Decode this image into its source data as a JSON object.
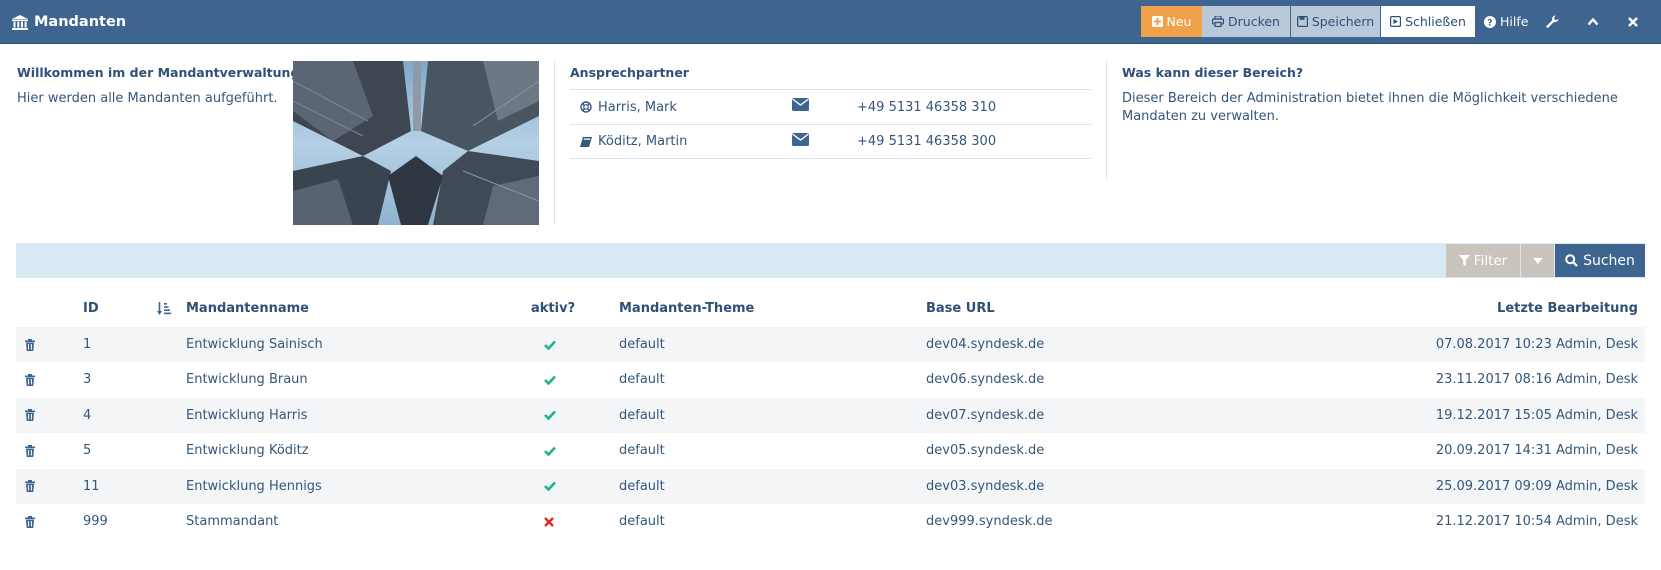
{
  "header": {
    "title": "Mandanten",
    "buttons": {
      "neu": "Neu",
      "drucken": "Drucken",
      "speichern": "Speichern",
      "schliessen": "Schließen",
      "hilfe": "Hilfe"
    }
  },
  "welcome": {
    "title": "Willkommen im der Mandantverwaltung",
    "text": "Hier werden alle Mandanten aufgeführt."
  },
  "contacts": {
    "title": "Ansprechpartner",
    "items": [
      {
        "name": "Harris, Mark",
        "icon": "lifebuoy-icon",
        "phone": "+49 5131 46358 310"
      },
      {
        "name": "Köditz, Martin",
        "icon": "book-icon",
        "phone": "+49 5131 46358 300"
      }
    ]
  },
  "about": {
    "title": "Was kann dieser Bereich?",
    "text_line1": "Dieser Bereich der Administration bietet ihnen die Möglichkeit verschiedene",
    "text_line2": "Mandaten zu verwalten."
  },
  "filter": {
    "filter_label": "Filter",
    "search_label": "Suchen"
  },
  "table": {
    "columns": {
      "id": "ID",
      "name": "Mandantenname",
      "active": "aktiv?",
      "theme": "Mandanten-Theme",
      "url": "Base URL",
      "last_edit": "Letzte Bearbeitung"
    },
    "rows": [
      {
        "id": "1",
        "name": "Entwicklung Sainisch",
        "active": true,
        "theme": "default",
        "url": "dev04.syndesk.de",
        "last_edit": "07.08.2017 10:23 Admin, Desk"
      },
      {
        "id": "3",
        "name": "Entwicklung Braun",
        "active": true,
        "theme": "default",
        "url": "dev06.syndesk.de",
        "last_edit": "23.11.2017 08:16 Admin, Desk"
      },
      {
        "id": "4",
        "name": "Entwicklung Harris",
        "active": true,
        "theme": "default",
        "url": "dev07.syndesk.de",
        "last_edit": "19.12.2017 15:05 Admin, Desk"
      },
      {
        "id": "5",
        "name": "Entwicklung Köditz",
        "active": true,
        "theme": "default",
        "url": "dev05.syndesk.de",
        "last_edit": "20.09.2017 14:31 Admin, Desk"
      },
      {
        "id": "11",
        "name": "Entwicklung Hennigs",
        "active": true,
        "theme": "default",
        "url": "dev03.syndesk.de",
        "last_edit": "25.09.2017 09:09 Admin, Desk"
      },
      {
        "id": "999",
        "name": "Stammandant",
        "active": false,
        "theme": "default",
        "url": "dev999.syndesk.de",
        "last_edit": "21.12.2017 10:54 Admin, Desk"
      }
    ]
  },
  "colors": {
    "header_bg": "#3d6590",
    "accent_orange": "#f0a24a",
    "check_green": "#1fb38a",
    "cross_red": "#e02424"
  }
}
